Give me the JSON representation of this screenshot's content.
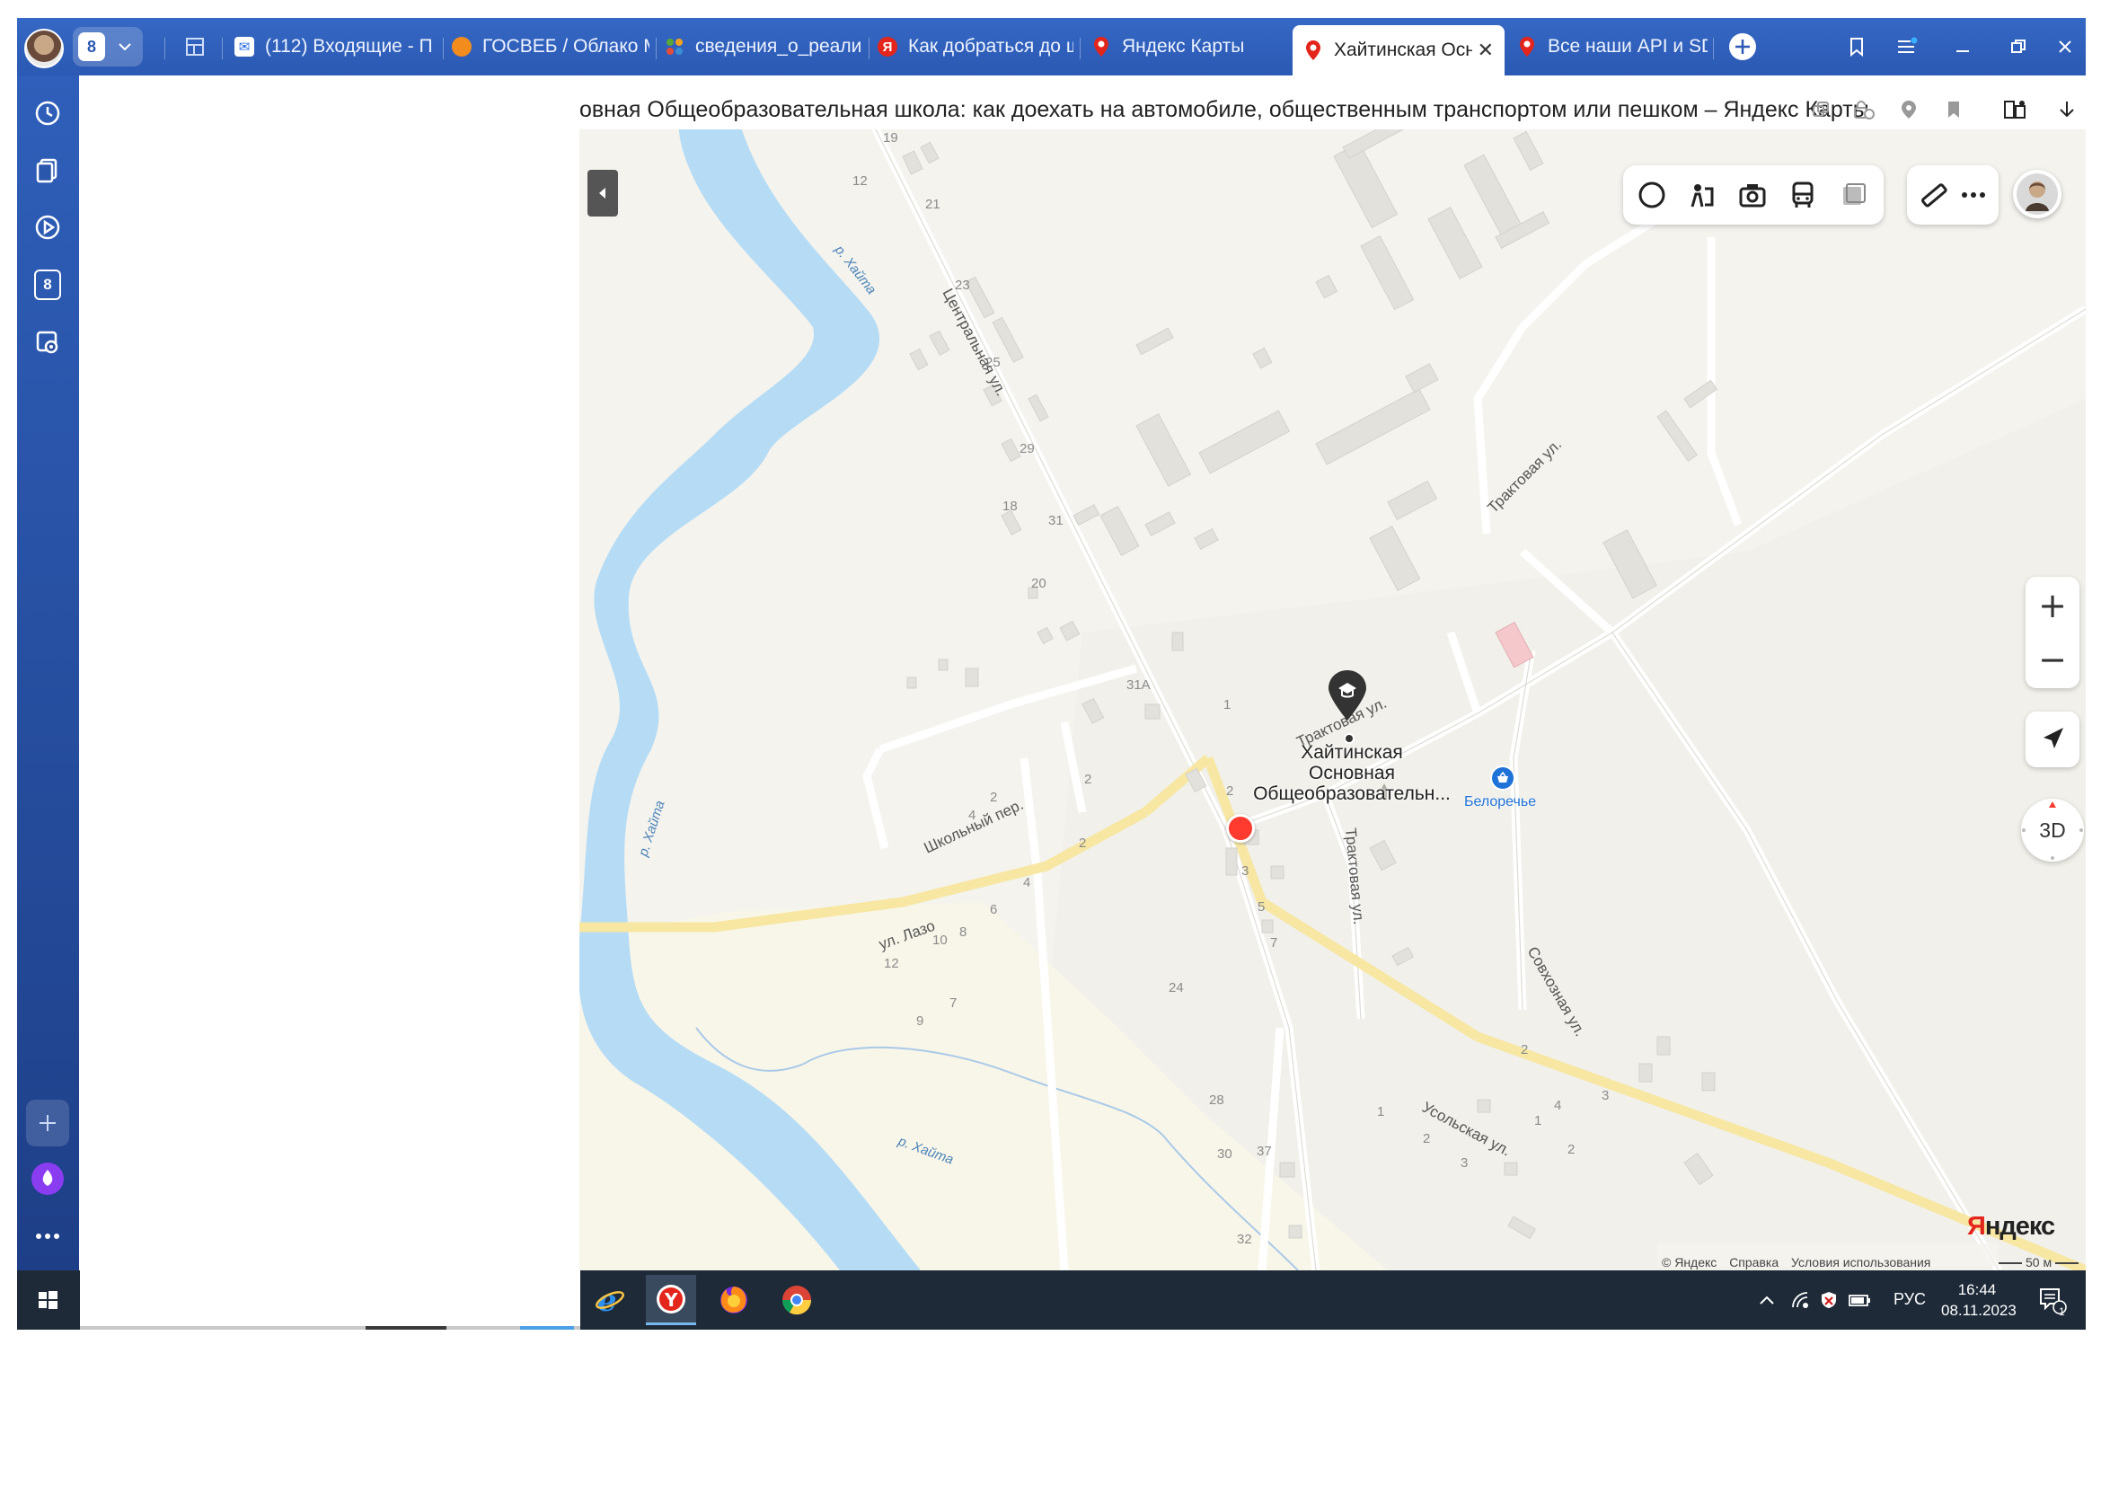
{
  "browser": {
    "tabs": [
      {
        "label": "(112) Входящие - П",
        "icon": "mail-icon",
        "color": "#1f6ae0"
      },
      {
        "label": "ГОСВЕБ / Облако М",
        "icon": "cloud-icon",
        "color": "#f28c1d"
      },
      {
        "label": "сведения_о_реализ",
        "icon": "joomla-icon",
        "color": "#5aa637"
      },
      {
        "label": "Как добраться до ш",
        "icon": "yandex-icon",
        "color": "#e4251b"
      },
      {
        "label": "Яндекс Карты",
        "icon": "map-pin-icon",
        "color": "#e4251b"
      },
      {
        "label": "Хайтинская Осно",
        "icon": "map-pin-icon",
        "color": "#e4251b",
        "active": true
      },
      {
        "label": "Все наши API и SDK",
        "icon": "map-pin-icon",
        "color": "#e4251b"
      }
    ],
    "tab_counter": "8",
    "page_title": "овная Общеобразовательная школа: как доехать на автомобиле, общественным транспортом или пешком – Яндекс Карты"
  },
  "sidebar": {
    "items": [
      {
        "name": "history-icon"
      },
      {
        "name": "collections-icon"
      },
      {
        "name": "video-icon"
      },
      {
        "name": "tab-counter-icon",
        "label": "8"
      },
      {
        "name": "screenshot-icon"
      }
    ]
  },
  "map": {
    "poi": {
      "name_lines": [
        "Хайтинская",
        "Основная",
        "Общеобразовательн..."
      ],
      "icon": "school-icon"
    },
    "shop": {
      "label": "Белоречье",
      "icon": "basket-icon"
    },
    "streets": [
      {
        "label": "Центральная ул."
      },
      {
        "label": "Трактовая ул."
      },
      {
        "label": "Трактовая ул."
      },
      {
        "label": "Трактовая ул."
      },
      {
        "label": "Школьный пер."
      },
      {
        "label": "ул. Лазо"
      },
      {
        "label": "Усольская ул."
      },
      {
        "label": "Совхозная ул."
      }
    ],
    "rivers": [
      {
        "label": "р. Хайта"
      },
      {
        "label": "р. Хайта"
      },
      {
        "label": "р. Хайта"
      }
    ],
    "house_numbers": [
      "19",
      "12",
      "21",
      "23",
      "25",
      "29",
      "18",
      "31",
      "20",
      "31А",
      "1",
      "2",
      "4",
      "2",
      "6",
      "4",
      "2",
      "8",
      "10",
      "12",
      "9",
      "7",
      "3",
      "5",
      "7",
      "24",
      "28",
      "30",
      "37",
      "32",
      "1",
      "2",
      "3",
      "2",
      "4",
      "1",
      "3",
      "1",
      "2"
    ],
    "controls": {
      "zoom_in": "+",
      "zoom_out": "−",
      "btn_3d": "3D"
    },
    "logo": {
      "main": "Яндекс"
    },
    "copyright": {
      "items": [
        "© Яндекс",
        "Справка",
        "Условия использования"
      ]
    },
    "scale": "50 м"
  },
  "taskbar": {
    "apps": [
      {
        "name": "internet-explorer-icon"
      },
      {
        "name": "yandex-browser-icon",
        "active": true
      },
      {
        "name": "firefox-icon"
      },
      {
        "name": "chrome-icon"
      }
    ],
    "language": "РУС",
    "time": "16:44",
    "date": "08.11.2023",
    "notification_count": "1"
  },
  "colors": {
    "accent": "#2b59b3",
    "map_bg": "#f4f3ee",
    "water": "#b6dcf5",
    "road_major": "#f7e7a3",
    "building": "#e2e1dc",
    "pin_red": "#ff3b30",
    "yandex_red": "#e4251b"
  }
}
